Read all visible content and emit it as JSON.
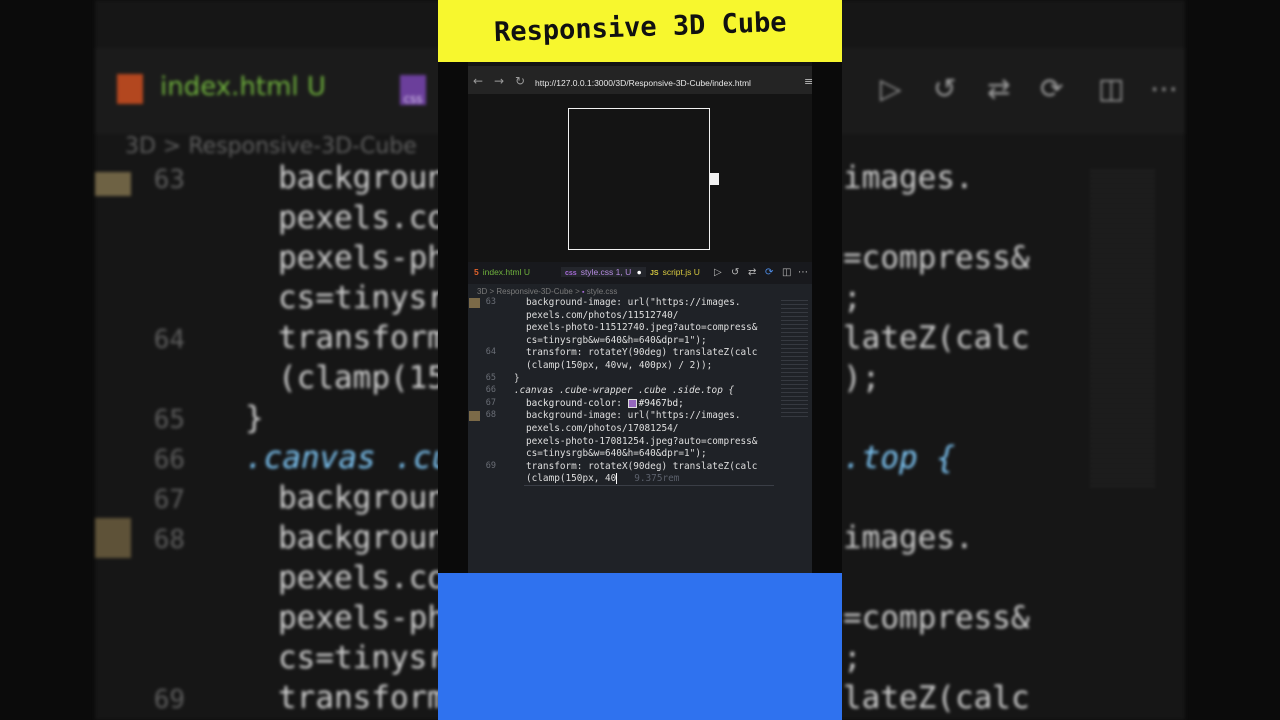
{
  "title": "Responsive 3D Cube",
  "colors": {
    "title_bg": "#f7f72e",
    "bottom_block": "#2f72ef",
    "swatch": "#9467bd"
  },
  "background_editor": {
    "tab_label": "index.html U",
    "css_badge": "css",
    "breadcrumb": "3D > Responsive-3D-Cube",
    "lines": [
      {
        "num": "63",
        "code": "backgroun",
        "right": "images."
      },
      {
        "num": "",
        "code": "pexels.co",
        "right": ""
      },
      {
        "num": "",
        "code": "pexels-ph",
        "right": "=compress&"
      },
      {
        "num": "",
        "code": "cs=tinysr",
        "right": ";"
      },
      {
        "num": "64",
        "code": "transform",
        "right": "lateZ(calc"
      },
      {
        "num": "",
        "code": "(clamp(15",
        "right": ");"
      },
      {
        "num": "65",
        "code": "}",
        "right": ""
      },
      {
        "num": "66",
        "code": ".canvas .cu",
        "right": ".top {"
      },
      {
        "num": "67",
        "code": "backgroun",
        "right": ""
      },
      {
        "num": "68",
        "code": "backgroun",
        "right": "images."
      },
      {
        "num": "",
        "code": "pexels.co",
        "right": ""
      },
      {
        "num": "",
        "code": "pexels-ph",
        "right": "=compress&"
      },
      {
        "num": "",
        "code": "cs=tinysr",
        "right": ";"
      },
      {
        "num": "69",
        "code": "transform",
        "right": "lateZ(calc"
      }
    ]
  },
  "browser": {
    "url": "http://127.0.0.1:3000/3D/Responsive-3D-Cube/index.html",
    "back_icon": "arrow-left-icon",
    "forward_icon": "arrow-right-icon",
    "reload_icon": "reload-icon",
    "menu_icon": "menu-icon"
  },
  "editor": {
    "tabs": [
      {
        "icon": "html5-icon",
        "icon_text": "5",
        "label": "index.html",
        "status": "U",
        "color": "#6fb13d"
      },
      {
        "icon": "css-icon",
        "icon_text": "css",
        "label": "style.css",
        "status": "1, U",
        "color": "#b58be0",
        "dirty": "●"
      },
      {
        "icon": "js-icon",
        "icon_text": "JS",
        "label": "script.js",
        "status": "U",
        "color": "#d7c940"
      }
    ],
    "breadcrumb": {
      "part1": "3D",
      "sep1": ">",
      "part2": "Responsive-3D-Cube",
      "sep2": ">",
      "part3": "style.css"
    },
    "code": [
      {
        "num": "63",
        "text": "background-image: url(\"https://images."
      },
      {
        "num": "",
        "text": "pexels.com/photos/11512740/"
      },
      {
        "num": "",
        "text": "pexels-photo-11512740.jpeg?auto=compress&"
      },
      {
        "num": "",
        "text": "cs=tinysrgb&w=640&h=640&dpr=1\");"
      },
      {
        "num": "64",
        "text": "transform: rotateY(90deg) translateZ(calc"
      },
      {
        "num": "",
        "text": "(clamp(150px, 40vw, 400px) / 2));"
      },
      {
        "num": "65",
        "text": "}"
      },
      {
        "num": "66",
        "text": ".canvas .cube-wrapper .cube .side.top {"
      },
      {
        "num": "67",
        "text_prop": "background-color: ",
        "text_val": "#9467bd;"
      },
      {
        "num": "68",
        "text": "background-image: url(\"https://images."
      },
      {
        "num": "",
        "text": "pexels.com/photos/17081254/"
      },
      {
        "num": "",
        "text": "pexels-photo-17081254.jpeg?auto=compress&"
      },
      {
        "num": "",
        "text": "cs=tinysrgb&w=640&h=640&dpr=1\");"
      },
      {
        "num": "69",
        "text": "transform: rotateX(90deg) translateZ(calc"
      },
      {
        "num": "",
        "text": "(clamp(150px, 40",
        "ghost": "9.375rem"
      }
    ]
  }
}
